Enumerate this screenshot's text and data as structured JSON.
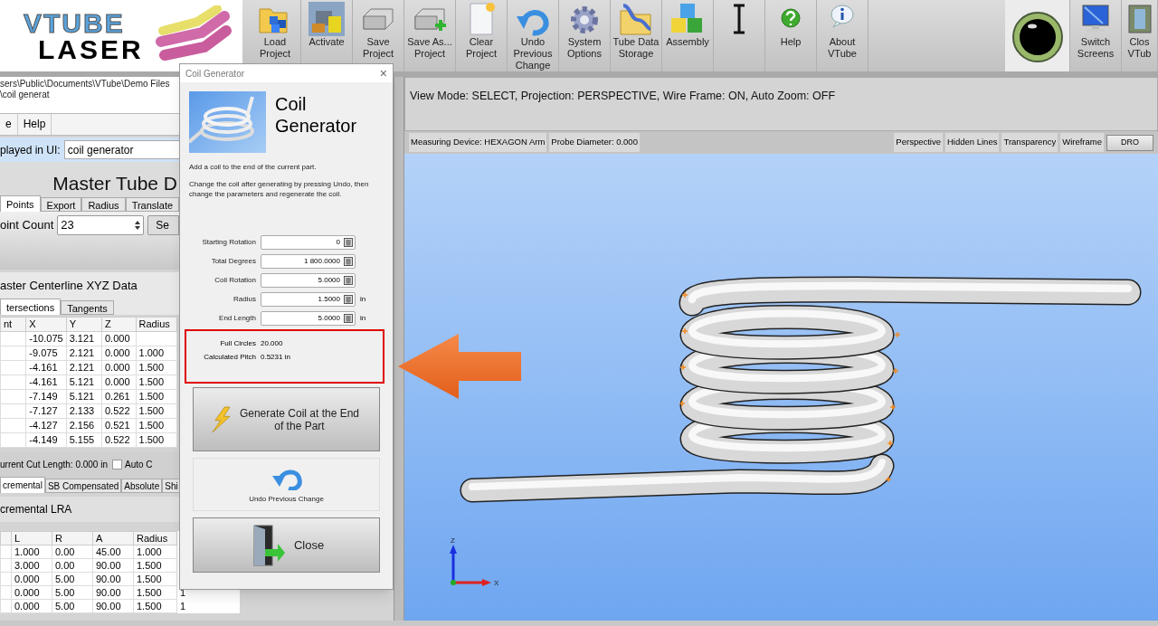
{
  "logo": {
    "line1": "VTUBE",
    "line2": "LASER"
  },
  "toolbar": [
    {
      "lines": [
        "Load",
        "Project"
      ],
      "kind": "folder"
    },
    {
      "lines": [
        "Activate"
      ],
      "kind": "machine"
    },
    {
      "lines": [
        "Save",
        "Project"
      ],
      "kind": "disk"
    },
    {
      "lines": [
        "Save As...",
        "Project"
      ],
      "kind": "diskplus"
    },
    {
      "lines": [
        "Clear",
        "Project"
      ],
      "kind": "page"
    },
    {
      "lines": [
        "Undo",
        "Previous",
        "Change"
      ],
      "kind": "undo"
    },
    {
      "lines": [
        "System",
        "Options"
      ],
      "kind": "gear"
    },
    {
      "lines": [
        "Tube Data",
        "Storage"
      ],
      "kind": "tubefolder"
    },
    {
      "lines": [
        "Assembly"
      ],
      "kind": "cubes"
    },
    {
      "kind": "cursor"
    },
    {
      "lines": [
        "Help"
      ],
      "kind": "help"
    },
    {
      "lines": [
        "About",
        "VTube"
      ],
      "kind": "info"
    },
    {
      "kind": "eye",
      "on": true
    },
    {
      "lines": [
        "Switch",
        "Screens"
      ],
      "kind": "monitor"
    },
    {
      "lines": [
        "Clos",
        "VTub"
      ],
      "kind": "door"
    }
  ],
  "left_panel": {
    "file_path": "sers\\Public\\Documents\\VTube\\Demo Files\\coil generat",
    "menu": [
      "e",
      "Help"
    ],
    "name_field": {
      "label": "played in UI:",
      "value": "coil generator"
    },
    "heading": "Master Tube D",
    "tabs": [
      {
        "label": "Points",
        "selected": true
      },
      {
        "label": "Export",
        "selected": false
      },
      {
        "label": "Radius",
        "selected": false
      },
      {
        "label": "Translate",
        "selected": false
      }
    ],
    "point_count": {
      "label": "oint Count",
      "value": "23",
      "button": "Se"
    },
    "xyz": {
      "title": "aster Centerline XYZ Data",
      "tabs": [
        {
          "label": "tersections",
          "selected": true
        },
        {
          "label": "Tangents",
          "selected": false
        }
      ],
      "columns": [
        "nt",
        "X",
        "Y",
        "Z",
        "Radius"
      ],
      "rows": [
        [
          "",
          "-10.075",
          "3.121",
          "0.000",
          ""
        ],
        [
          "",
          "-9.075",
          "2.121",
          "0.000",
          "1.000"
        ],
        [
          "",
          "-4.161",
          "2.121",
          "0.000",
          "1.500"
        ],
        [
          "",
          "-4.161",
          "5.121",
          "0.000",
          "1.500"
        ],
        [
          "",
          "-7.149",
          "5.121",
          "0.261",
          "1.500"
        ],
        [
          "",
          "-7.127",
          "2.133",
          "0.522",
          "1.500"
        ],
        [
          "",
          "-4.127",
          "2.156",
          "0.521",
          "1.500"
        ],
        [
          "",
          "-4.149",
          "5.155",
          "0.522",
          "1.500"
        ]
      ]
    },
    "cut_length": "urrent Cut Length: 0.000 in",
    "auto_checkbox": {
      "label": "Auto C",
      "checked": false
    },
    "lra_tabs": [
      {
        "label": "cremental",
        "selected": true
      },
      {
        "label": "SB Compensated",
        "selected": false
      },
      {
        "label": "Absolute",
        "selected": false
      },
      {
        "label": "Shi",
        "selected": false
      }
    ],
    "lra": {
      "title": "cremental LRA",
      "columns": [
        "",
        "L",
        "R",
        "A",
        "Radius"
      ],
      "rows": [
        [
          "",
          "1.000",
          "0.00",
          "45.00",
          "1.000",
          ""
        ],
        [
          "",
          "3.000",
          "0.00",
          "90.00",
          "1.500",
          ""
        ],
        [
          "",
          "0.000",
          "5.00",
          "90.00",
          "1.500",
          ""
        ],
        [
          "",
          "0.000",
          "5.00",
          "90.00",
          "1.500",
          "1"
        ],
        [
          "",
          "0.000",
          "5.00",
          "90.00",
          "1.500",
          "1"
        ]
      ]
    }
  },
  "dialog": {
    "title": "Coil Generator",
    "close": "×",
    "heading": "Coil Generator",
    "description": [
      "Add a coil to the end of the current part.",
      "Change the coil after generating by pressing Undo, then change the parameters and regenerate the coil."
    ],
    "fields": [
      {
        "label": "Starting Rotation",
        "value": "0"
      },
      {
        "label": "Total Degrees",
        "value": "1 800.0000"
      },
      {
        "label": "Coil Rotation",
        "value": "5.0000"
      },
      {
        "label": "Radius",
        "value": "1.5000",
        "unit": "in"
      },
      {
        "label": "End Length",
        "value": "5.0000",
        "unit": "in"
      }
    ],
    "results": [
      {
        "label": "Full Circles",
        "value": "20.000"
      },
      {
        "label": "Calculated Pitch",
        "value": "0.5231 in"
      }
    ],
    "buttons": [
      {
        "kind": "generate",
        "label": "Generate Coil at the End of the Part"
      },
      {
        "kind": "undo",
        "label": "Undo Previous Change"
      },
      {
        "kind": "close",
        "label": "Close"
      }
    ]
  },
  "viewer": {
    "status": "View Mode: SELECT, Projection: PERSPECTIVE, Wire Frame: ON, Auto Zoom: OFF",
    "info": [
      "Measuring Device: HEXAGON Arm",
      "Probe Diameter: 0.000"
    ],
    "toggles": [
      "Perspective",
      "Hidden Lines",
      "Transparency",
      "Wireframe"
    ],
    "dro": "DRO",
    "axes": [
      "Z",
      "X"
    ]
  }
}
